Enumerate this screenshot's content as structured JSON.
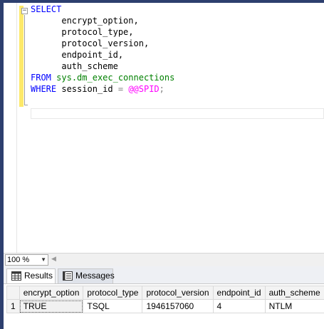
{
  "editor": {
    "code": {
      "select_kw": "SELECT",
      "col1": "encrypt_option,",
      "col2": "protocol_type,",
      "col3": "protocol_version,",
      "col4": "endpoint_id,",
      "col5": "auth_scheme",
      "from_kw": "FROM",
      "from_obj": "sys.dm_exec_connections",
      "where_kw": "WHERE",
      "where_col": "session_id",
      "where_op": "=",
      "where_fn": "@@SPID",
      "semicolon": ";"
    }
  },
  "zoom": {
    "value": "100 %"
  },
  "tabs": {
    "results": "Results",
    "messages": "Messages"
  },
  "grid": {
    "columns": [
      "encrypt_option",
      "protocol_type",
      "protocol_version",
      "endpoint_id",
      "auth_scheme"
    ],
    "rows": [
      {
        "num": "1",
        "cells": [
          "TRUE",
          "TSQL",
          "1946157060",
          "4",
          "NTLM"
        ]
      }
    ]
  },
  "colors": {
    "keyword": "#0000ff",
    "system_object": "#008000",
    "function": "#ff00ff",
    "change_bar": "#fde96a",
    "chrome": "#2d3f6e"
  },
  "icons": {
    "results_tab": "grid-icon",
    "messages_tab": "messages-icon",
    "collapse": "collapse-minus-icon",
    "zoom_dropdown": "chevron-down-icon"
  }
}
